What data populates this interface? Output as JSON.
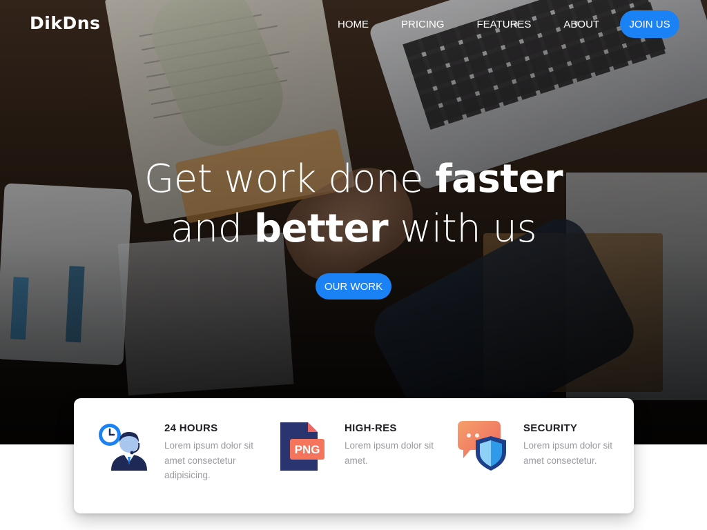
{
  "brand": {
    "name": "DikDns"
  },
  "nav": {
    "items": [
      "HOME",
      "PRICING",
      "FEATURES",
      "ABOUT"
    ],
    "join_label": "JOIN US"
  },
  "hero": {
    "line1_light": "Get work done ",
    "line1_bold": "faster",
    "line2_light_a": "and ",
    "line2_bold": "better",
    "line2_light_b": " with us",
    "cta_label": "OUR WORK"
  },
  "features": [
    {
      "title": "24 HOURS",
      "desc": "Lorem ipsum dolor sit amet consectetur adipisicing.",
      "icon": "support-agent-clock-icon"
    },
    {
      "title": "HIGH-RES",
      "desc": "Lorem ipsum dolor sit amet.",
      "icon": "png-file-icon",
      "icon_text": "PNG"
    },
    {
      "title": "SECURITY",
      "desc": "Lorem ipsum dolor sit amet consectetur.",
      "icon": "shield-chat-icon"
    }
  ],
  "colors": {
    "accent": "#1a82f5",
    "title": "#1e1e24",
    "muted": "#9a9aa2"
  }
}
